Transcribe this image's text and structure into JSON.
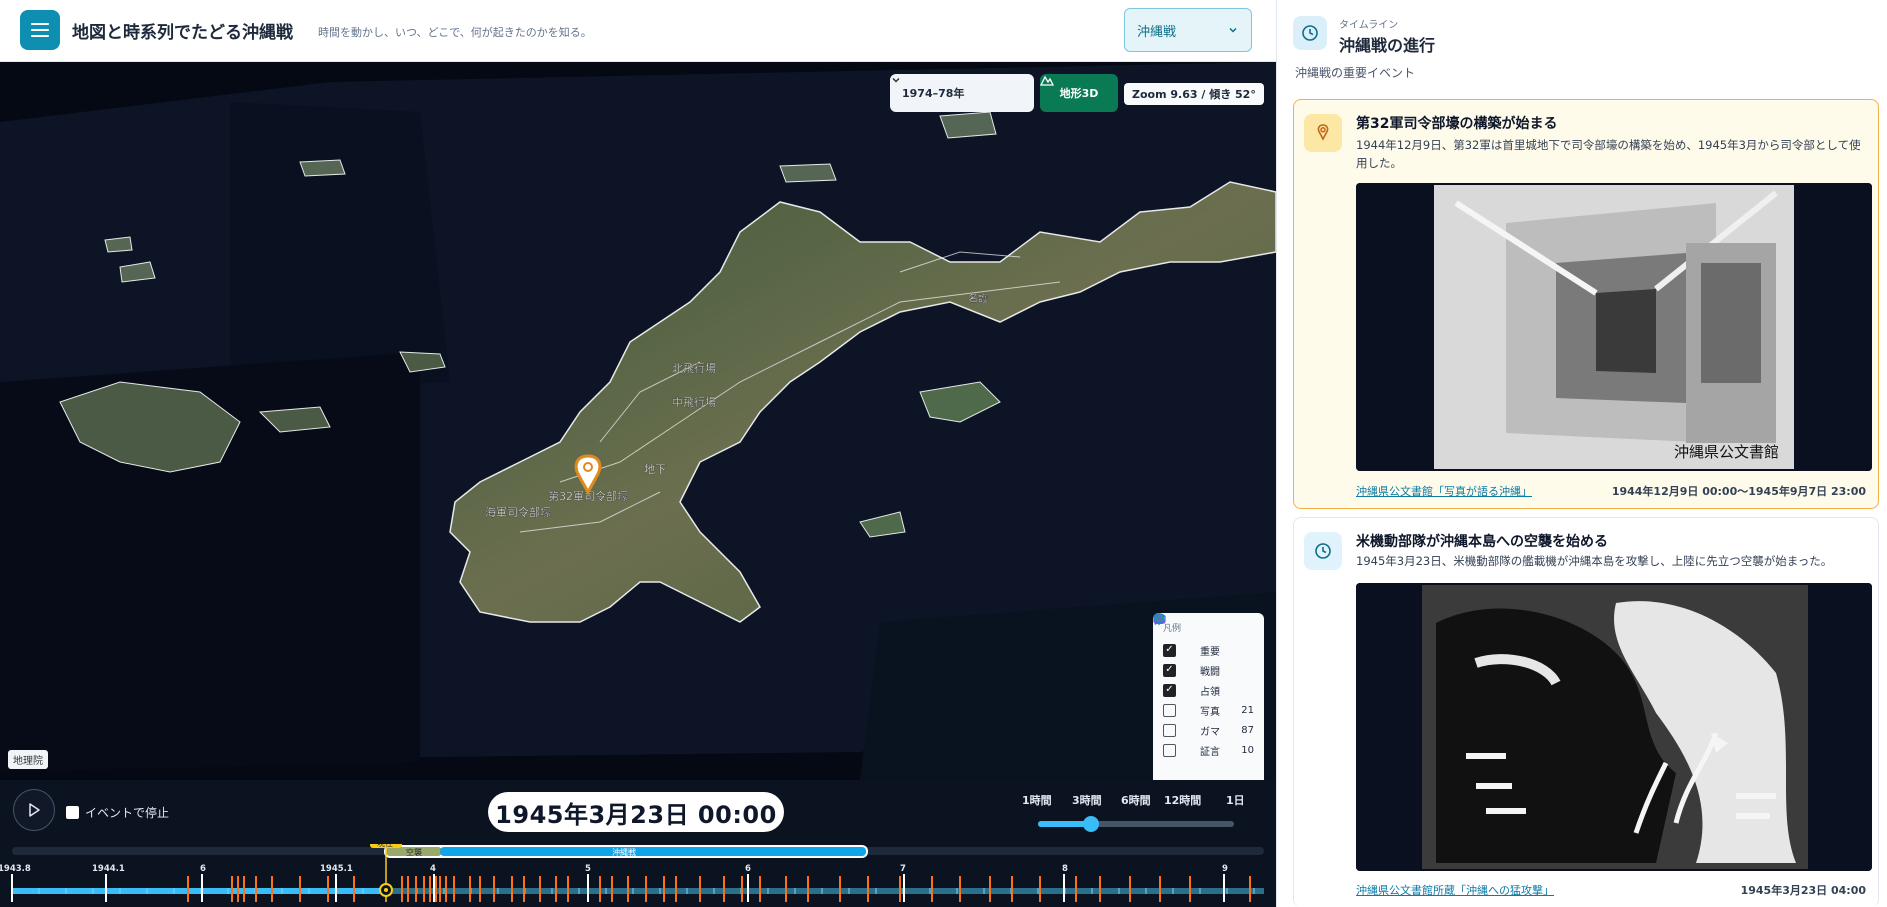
{
  "header": {
    "title": "地図と時系列でたどる沖縄戦",
    "subtitle": "時間を動かし、いつ、どこで、何が起きたのかを知る。",
    "topic_select": "沖縄戦"
  },
  "map": {
    "year_select": "1974–78年",
    "terrain_button": "地形3D",
    "zoom_info": "Zoom 9.63 / 傾き 52°",
    "attribution": "地理院",
    "labels": {
      "north_airfield": "北飛行場",
      "central_airfield": "中飛行場",
      "hq32": "第32軍司令部壕",
      "navy_hq": "海軍司令部壕",
      "underground": "地下",
      "nago": "名護"
    }
  },
  "legend": {
    "title": "凡例",
    "items": [
      {
        "label": "重要",
        "checked": true,
        "count": "",
        "icon": "pin-icon",
        "color": "#e08a1e"
      },
      {
        "label": "戦闘",
        "checked": true,
        "count": "",
        "icon": "cross-swords-icon",
        "color": "#d32f2f"
      },
      {
        "label": "占領",
        "checked": true,
        "count": "",
        "icon": "square-icon",
        "color": "#4f6de6"
      },
      {
        "label": "写真",
        "checked": false,
        "count": "21",
        "icon": "camera-icon",
        "color": "#9b4de0"
      },
      {
        "label": "ガマ",
        "checked": false,
        "count": "87",
        "icon": "cave-pin-icon",
        "color": "#22a06b"
      },
      {
        "label": "証言",
        "checked": false,
        "count": "10",
        "icon": "speech-icon",
        "color": "#2a7ad8"
      }
    ]
  },
  "timeline": {
    "stop_on_event": "イベントで停止",
    "current_datetime": "1945年3月23日 00:00",
    "speed_labels": [
      "1時間",
      "3時間",
      "6時間",
      "12時間",
      "1日"
    ],
    "speed_value": 0.27,
    "now_label": "現在",
    "period_labels": [
      "空襲",
      "沖縄戦"
    ],
    "tick_labels": [
      "1943.8",
      "1944.1",
      "6",
      "1945.1",
      "4",
      "5",
      "6",
      "7",
      "8",
      "9"
    ]
  },
  "sidebar": {
    "kicker": "タイムライン",
    "title": "沖縄戦の進行",
    "subtitle": "沖縄戦の重要イベント",
    "cards": [
      {
        "title": "第32軍司令部壕の構築が始まる",
        "description": "1944年12月9日、第32軍は首里城地下で司令部壕の構築を始め、1945年3月から司令部として使用した。",
        "image_caption": "沖縄県公文書館",
        "source": "沖縄県公文書館「写真が語る沖縄」",
        "date": "1944年12月9日 00:00〜1945年9月7日 23:00"
      },
      {
        "title": "米機動部隊が沖縄本島への空襲を始める",
        "description": "1945年3月23日、米機動部隊の艦載機が沖縄本島を攻撃し、上陸に先立つ空襲が始まった。",
        "source": "沖縄県公文書館所蔵「沖縄への猛攻撃」",
        "date": "1945年3月23日 04:00"
      }
    ]
  }
}
